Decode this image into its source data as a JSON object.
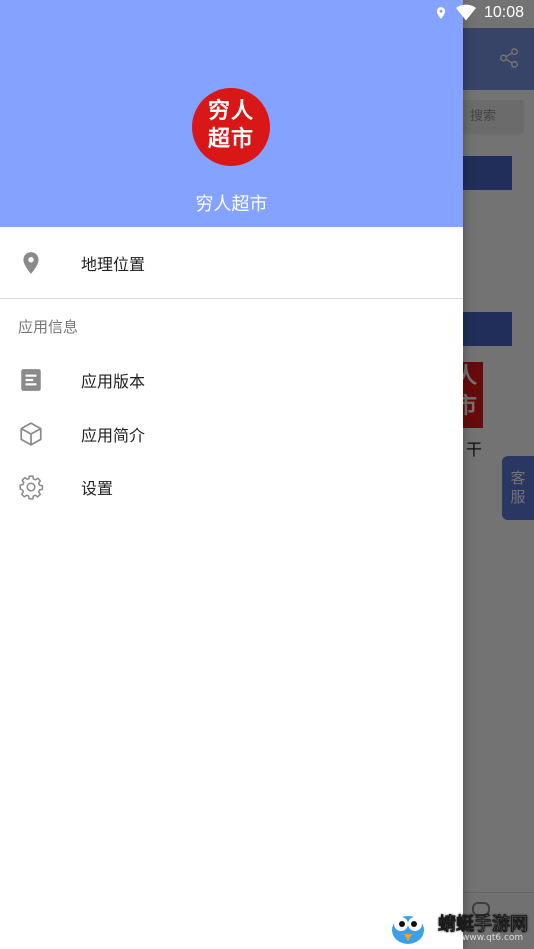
{
  "status_bar": {
    "time": "10:08",
    "icons": [
      "location-icon",
      "wifi-icon"
    ]
  },
  "background": {
    "search_text": "搜索",
    "logo_text": "人\n市",
    "snippet_text": "干",
    "customer_service": "客\n服"
  },
  "drawer": {
    "header": {
      "avatar_text": "穷人\n超市",
      "app_name": "穷人超市",
      "background_color": "#84A2FF",
      "avatar_color": "#DA1717"
    },
    "location_item": {
      "label": "地理位置",
      "icon": "location-pin-icon"
    },
    "section_title": "应用信息",
    "items": [
      {
        "label": "应用版本",
        "icon": "document-icon"
      },
      {
        "label": "应用简介",
        "icon": "cube-icon"
      },
      {
        "label": "设置",
        "icon": "gear-icon"
      }
    ]
  },
  "watermark": {
    "text": "蜻蜓手游网",
    "url": "www.qt6.com"
  }
}
